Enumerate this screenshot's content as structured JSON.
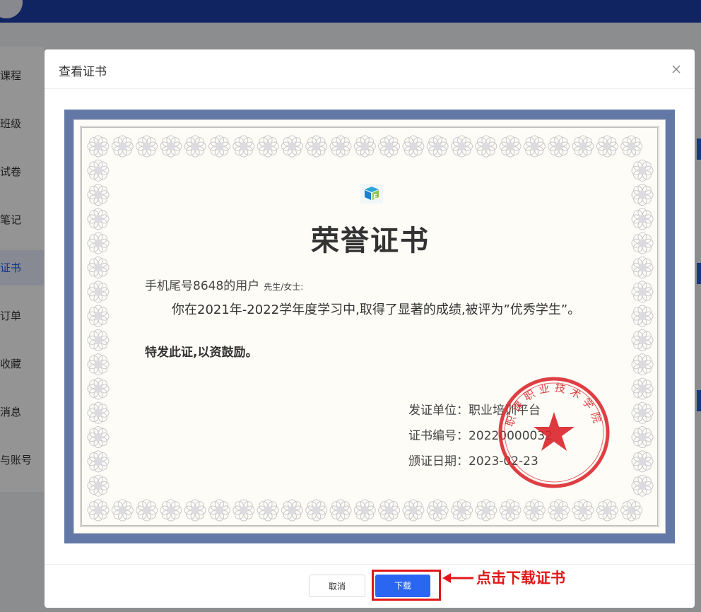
{
  "sidebar": {
    "items": [
      {
        "label": "课程"
      },
      {
        "label": "班级"
      },
      {
        "label": "试卷"
      },
      {
        "label": "笔记"
      },
      {
        "label": "证书",
        "active": true
      },
      {
        "label": "订单"
      },
      {
        "label": "收藏"
      },
      {
        "label": "消息"
      },
      {
        "label": "与账号"
      }
    ]
  },
  "modal": {
    "title": "查看证书",
    "close_icon": "close-icon",
    "footer": {
      "cancel_label": "取消",
      "download_label": "下载"
    }
  },
  "certificate": {
    "title": "荣誉证书",
    "recipient": "手机尾号8648的用户",
    "recipient_suffix": "先生/女士:",
    "body": "你在2021年-2022学年度学习中,取得了显著的成绩,被评为”优秀学生”。",
    "body2": "特发此证,以资鼓励。",
    "issuer": "发证单位：职业培训平台",
    "number": "证书编号：20220000032",
    "date": "颁证日期：2023-02-23",
    "seal_text": "职课职业技术学院",
    "colors": {
      "border": "#6478a8",
      "seal": "#d9242b",
      "paper": "#fdfcf6"
    }
  },
  "annotation": {
    "text": "点击下载证书",
    "color": "#e01818"
  }
}
